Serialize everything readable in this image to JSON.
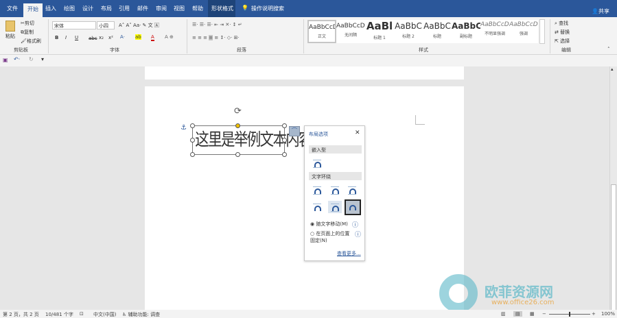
{
  "tabs": [
    "文件",
    "开始",
    "插入",
    "绘图",
    "设计",
    "布局",
    "引用",
    "邮件",
    "审阅",
    "视图",
    "帮助",
    "形状格式"
  ],
  "search": "操作说明搜索",
  "share": "共享",
  "clipboard": {
    "paste": "粘贴",
    "cut": "剪切",
    "copy": "复制",
    "painter": "格式刷",
    "label": "剪贴板"
  },
  "font": {
    "name": "宋体",
    "size": "小四",
    "label": "字体",
    "bold": "B",
    "italic": "I",
    "underline": "U",
    "strike": "abc",
    "sub": "x₂",
    "sup": "x²"
  },
  "paragraph": {
    "label": "段落"
  },
  "styles": {
    "label": "样式",
    "items": [
      {
        "sample": "AaBbCcDc",
        "name": "正文"
      },
      {
        "sample": "AaBbCcDc",
        "name": "无间隔"
      },
      {
        "sample": "AaBl",
        "name": "标题 1"
      },
      {
        "sample": "AaBbC",
        "name": "标题 2"
      },
      {
        "sample": "AaBbC",
        "name": "标题"
      },
      {
        "sample": "AaBbC",
        "name": "副标题"
      },
      {
        "sample": "AaBbCcDc",
        "name": "不明显强调"
      },
      {
        "sample": "AaBbCcDc",
        "name": "强调"
      }
    ]
  },
  "editing": {
    "find": "查找",
    "replace": "替换",
    "select": "选择",
    "label": "编辑"
  },
  "document": {
    "textbox": "这里是举例文本内容。"
  },
  "layout_panel": {
    "title": "布局选项",
    "inline": "嵌入型",
    "wrap": "文字环绕",
    "move_with_text": "随文字移动(M)",
    "fix_position": "在页面上的位置固定(N)",
    "see_more": "查看更多..."
  },
  "status": {
    "page": "第 2 页，共 2 页",
    "words": "10/481 个字",
    "lang": "中文(中国)",
    "accessibility": "辅助功能: 调查",
    "zoom": "100%"
  },
  "watermark": {
    "name": "欧菲资源网",
    "url": "www.office26.com"
  },
  "colors": {
    "accent": "#2b579a"
  }
}
